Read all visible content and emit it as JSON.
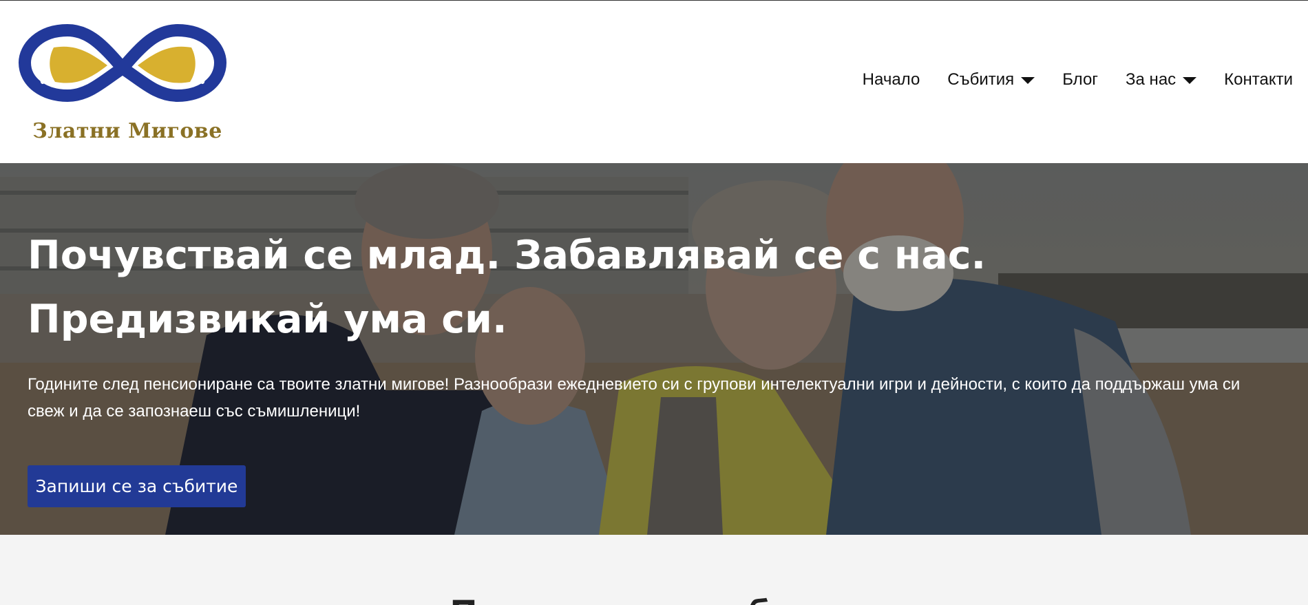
{
  "brand": {
    "name": "Златни Мигове",
    "colors": {
      "blue": "#22399a",
      "gold": "#d8b02f",
      "text_gold": "#8a7125"
    }
  },
  "nav": {
    "items": [
      {
        "label": "Начало",
        "has_dropdown": false
      },
      {
        "label": "Събития",
        "has_dropdown": true
      },
      {
        "label": "Блог",
        "has_dropdown": false
      },
      {
        "label": "За нас",
        "has_dropdown": true
      },
      {
        "label": "Контакти",
        "has_dropdown": false
      }
    ]
  },
  "hero": {
    "title": "Почувствай се млад. Забавлявай се с нас. Предизвикай ума си.",
    "text": "Годините след пенсиониране са твоите златни мигове! Разнообрази ежедневието си с групови интелектуални игри и дейности, с които да поддържаш ума си свеж и да се запознаеш със съмишленици!",
    "button_label": "Запиши се за събитие",
    "button_color": "#223a96"
  },
  "next_section": {
    "title": "Предстоящи събития"
  }
}
